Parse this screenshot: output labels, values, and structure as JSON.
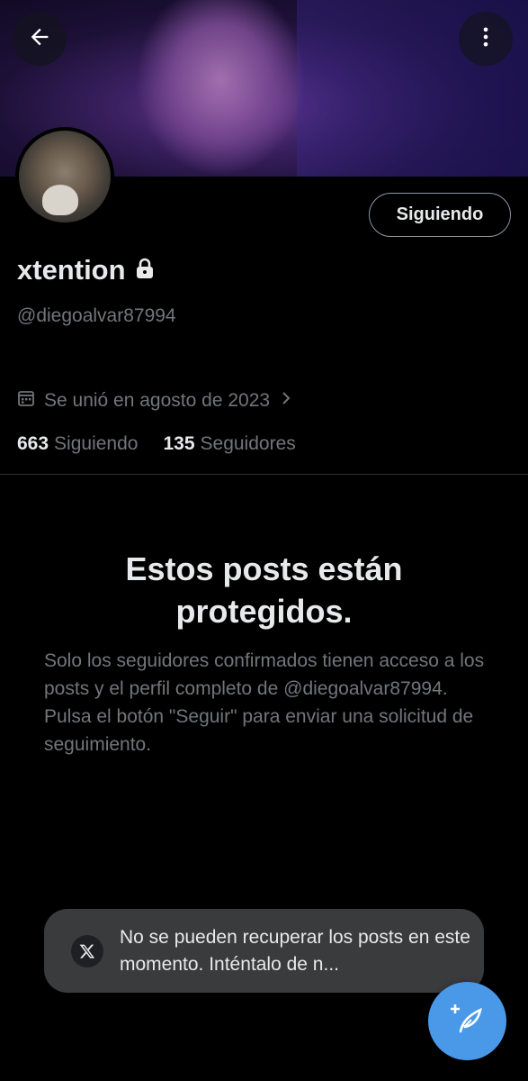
{
  "profile": {
    "display_name": "xtention",
    "handle": "@diegoalvar87994",
    "joined": "Se unió en agosto de 2023",
    "following_count": "663",
    "following_label": "Siguiendo",
    "followers_count": "135",
    "followers_label": "Seguidores",
    "follow_button_label": "Siguiendo"
  },
  "protected": {
    "title": "Estos posts están protegidos.",
    "body": "Solo los seguidores confirmados tienen acceso a los posts y el perfil completo de @diegoalvar87994. Pulsa el botón \"Seguir\" para enviar una solicitud de seguimiento."
  },
  "toast": {
    "message": "No se pueden recuperar los posts en este momento. Inténtalo de n..."
  },
  "icons": {
    "back": "arrow-left-icon",
    "more": "more-vertical-icon",
    "lock": "lock-icon",
    "calendar": "calendar-icon",
    "chevron": "chevron-right-icon",
    "x_logo": "x-logo-icon",
    "compose": "compose-post-icon"
  },
  "colors": {
    "background": "#000000",
    "primary_text": "#e7e9ea",
    "secondary_text": "#71767b",
    "accent": "#4a99e9",
    "toast_bg": "#3a3b3d"
  }
}
